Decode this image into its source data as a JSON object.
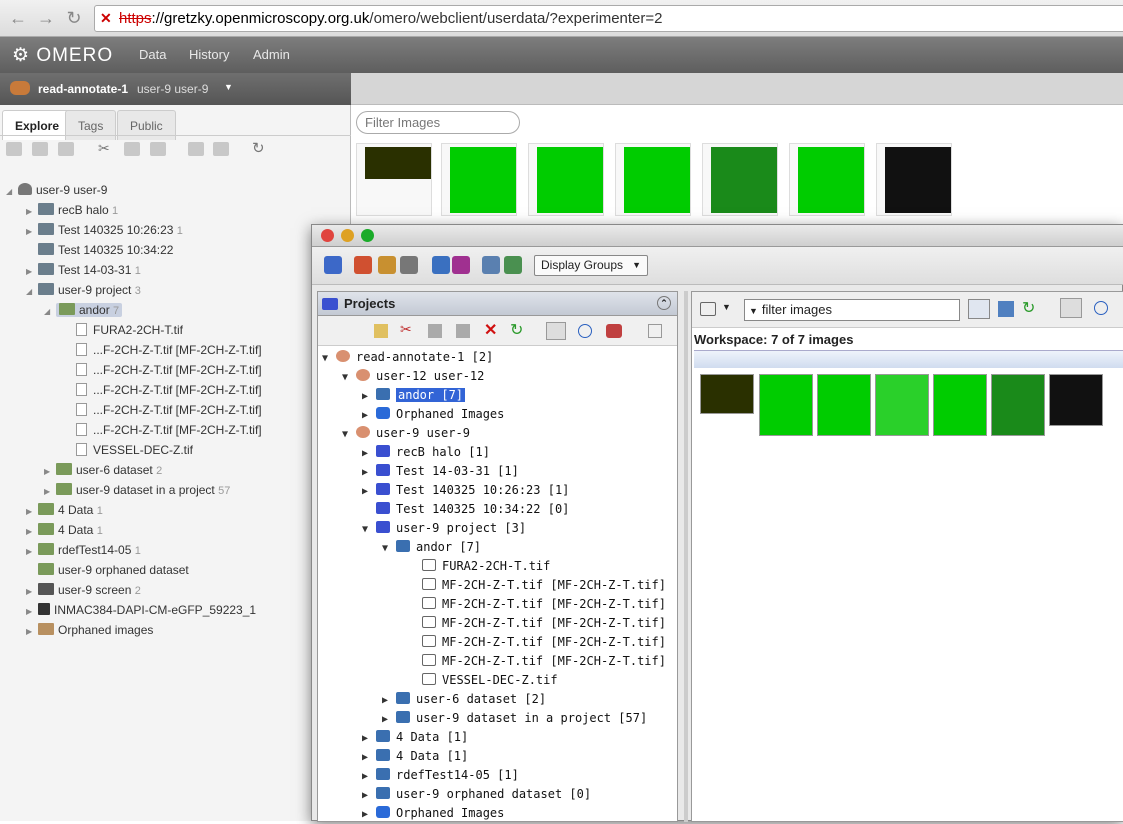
{
  "browser": {
    "url_scheme": "https",
    "url_host": "://gretzky.openmicroscopy.org.uk",
    "url_path": "/omero/webclient/userdata/?experimenter=2"
  },
  "topbar": {
    "logo": "OMERO",
    "nav": [
      "Data",
      "History",
      "Admin"
    ]
  },
  "userbar": {
    "group": "read-annotate-1",
    "user": "user-9 user-9"
  },
  "left": {
    "tabs": [
      "Explore",
      "Tags",
      "Public"
    ],
    "root": "user-9 user-9",
    "tree": [
      {
        "label": "recB halo",
        "count": "1"
      },
      {
        "label": "Test 140325 10:26:23",
        "count": "1"
      },
      {
        "label": "Test 140325 10:34:22",
        "count": ""
      },
      {
        "label": "Test 14-03-31",
        "count": "1"
      },
      {
        "label": "user-9 project",
        "count": "3"
      },
      {
        "label": "andor",
        "count": "7"
      },
      {
        "label": "FURA2-2CH-T.tif",
        "count": ""
      },
      {
        "label": "...F-2CH-Z-T.tif [MF-2CH-Z-T.tif]",
        "count": ""
      },
      {
        "label": "...F-2CH-Z-T.tif [MF-2CH-Z-T.tif]",
        "count": ""
      },
      {
        "label": "...F-2CH-Z-T.tif [MF-2CH-Z-T.tif]",
        "count": ""
      },
      {
        "label": "...F-2CH-Z-T.tif [MF-2CH-Z-T.tif]",
        "count": ""
      },
      {
        "label": "...F-2CH-Z-T.tif [MF-2CH-Z-T.tif]",
        "count": ""
      },
      {
        "label": "VESSEL-DEC-Z.tif",
        "count": ""
      },
      {
        "label": "user-6 dataset",
        "count": "2"
      },
      {
        "label": "user-9 dataset in a project",
        "count": "57"
      },
      {
        "label": "4 Data",
        "count": "1"
      },
      {
        "label": "4 Data",
        "count": "1"
      },
      {
        "label": "rdefTest14-05",
        "count": "1"
      },
      {
        "label": "user-9 orphaned dataset",
        "count": ""
      },
      {
        "label": "user-9 screen",
        "count": "2"
      },
      {
        "label": "INMAC384-DAPI-CM-eGFP_59223_1",
        "count": ""
      },
      {
        "label": "Orphaned images",
        "count": ""
      }
    ]
  },
  "right": {
    "filter_placeholder": "Filter Images"
  },
  "insight": {
    "display_groups": "Display Groups",
    "projects_title": "Projects",
    "tree": [
      "read-annotate-1 [2]",
      "user-12 user-12",
      "andor [7]",
      "Orphaned Images",
      "user-9 user-9",
      "recB halo [1]",
      "Test 14-03-31 [1]",
      "Test 140325 10:26:23 [1]",
      "Test 140325 10:34:22 [0]",
      "user-9 project [3]",
      "andor [7]",
      "FURA2-2CH-T.tif",
      "MF-2CH-Z-T.tif [MF-2CH-Z-T.tif]",
      "MF-2CH-Z-T.tif [MF-2CH-Z-T.tif]",
      "MF-2CH-Z-T.tif [MF-2CH-Z-T.tif]",
      "MF-2CH-Z-T.tif [MF-2CH-Z-T.tif]",
      "MF-2CH-Z-T.tif [MF-2CH-Z-T.tif]",
      "VESSEL-DEC-Z.tif",
      "user-6 dataset [2]",
      "user-9 dataset in a project [57]",
      "4 Data [1]",
      "4 Data [1]",
      "rdefTest14-05 [1]",
      "user-9 orphaned dataset [0]",
      "Orphaned Images"
    ],
    "ws_filter": "filter  images",
    "ws_label": "Workspace: 7 of 7 images"
  }
}
